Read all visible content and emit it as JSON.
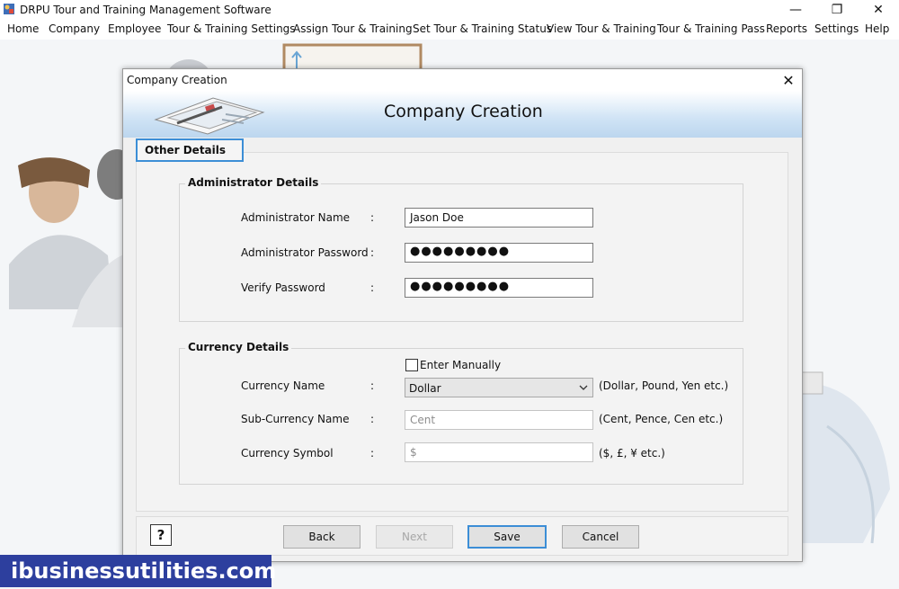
{
  "app": {
    "title": "DRPU Tour and Training Management Software",
    "window_controls": [
      "—",
      "❐",
      "✕"
    ]
  },
  "menu": [
    "Home",
    "Company",
    "Employee",
    "Tour & Training Settings",
    "Assign Tour & Training",
    "Set Tour & Training Status",
    "View Tour & Training",
    "Tour & Training Pass",
    "Reports",
    "Settings",
    "Help"
  ],
  "dialog": {
    "window_title": "Company Creation",
    "close_glyph": "✕",
    "banner_title": "Company Creation",
    "tab_label": "Other Details",
    "administrator": {
      "legend": "Administrator Details",
      "name_label": "Administrator Name",
      "name_value": "Jason Doe",
      "password_label": "Administrator Password",
      "password_value": "●●●●●●●●●",
      "verify_label": "Verify Password",
      "verify_value": "●●●●●●●●●",
      "colon": ":"
    },
    "currency": {
      "legend": "Currency Details",
      "manual_label": "Enter Manually",
      "manual_checked": false,
      "name_label": "Currency Name",
      "name_value": "Dollar",
      "name_hint": "(Dollar, Pound, Yen etc.)",
      "sub_label": "Sub-Currency Name",
      "sub_placeholder": "Cent",
      "sub_hint": "(Cent, Pence, Cen etc.)",
      "symbol_label": "Currency Symbol",
      "symbol_placeholder": "$",
      "symbol_hint": "($, £, ¥ etc.)",
      "colon": ":"
    },
    "buttons": {
      "help": "?",
      "back": "Back",
      "next": "Next",
      "save": "Save",
      "cancel": "Cancel"
    }
  },
  "watermark": "ibusinessutilities.com",
  "colors": {
    "accent": "#3c8ed6",
    "watermark_bg": "#2d3f9e"
  },
  "icons": {
    "app": "app-logo-icon",
    "chevron": "chevron-down-icon"
  }
}
